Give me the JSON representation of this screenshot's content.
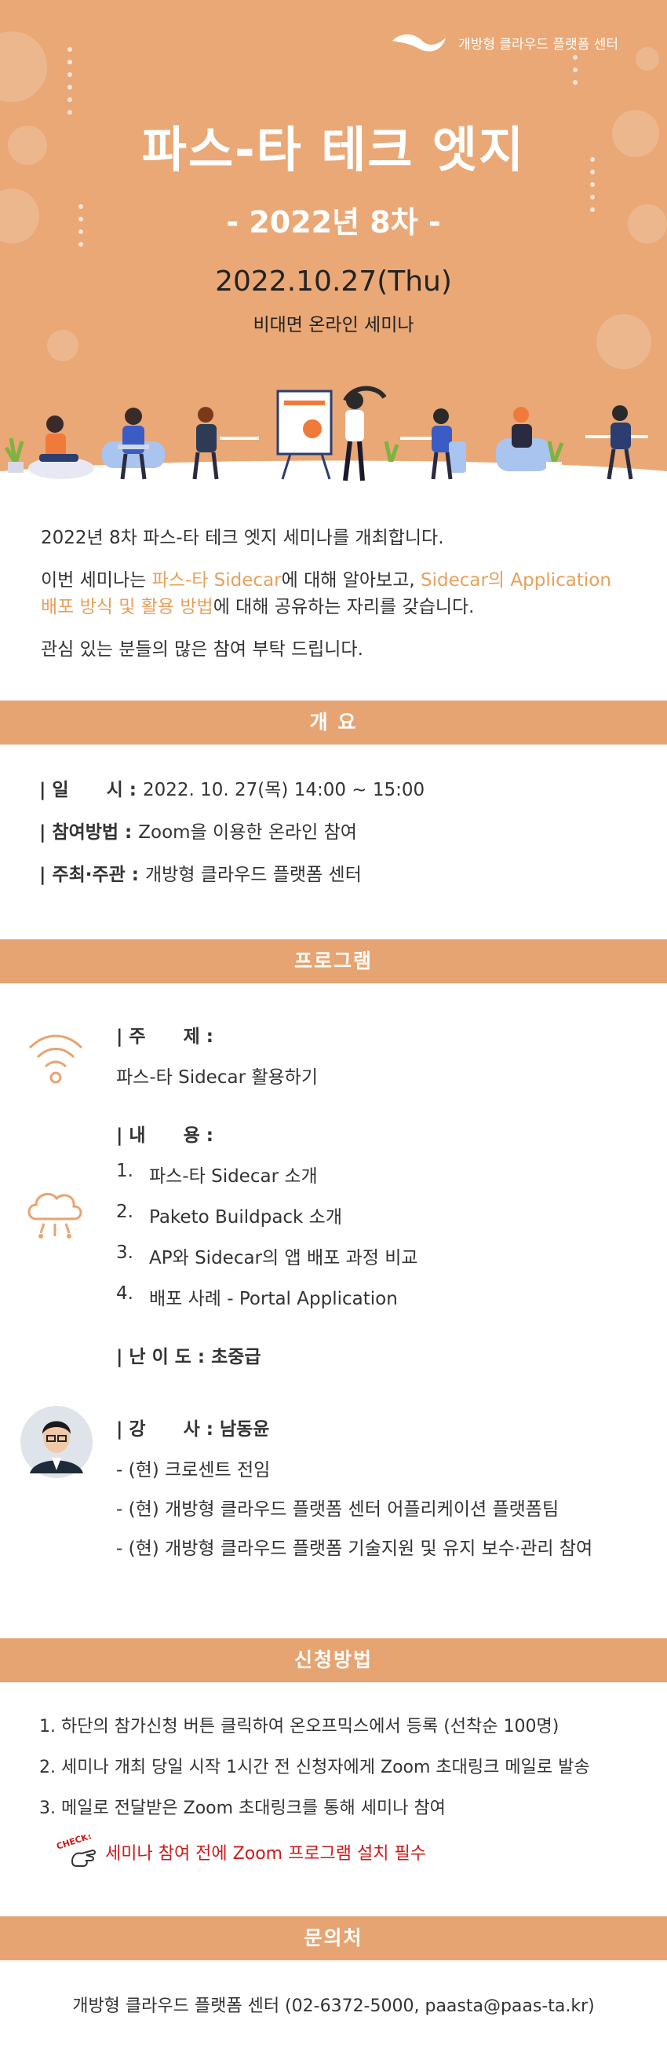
{
  "brand": {
    "name": "개방형 클라우드 플랫폼 센터",
    "logo_icon": "cloud-wave-logo"
  },
  "hero": {
    "title": "파스-타 테크 엣지",
    "subtitle": "- 2022년 8차 -",
    "date": "2022.10.27(Thu)",
    "kind": "비대면 온라인 세미나"
  },
  "intro": {
    "p1": "2022년 8차 파스-타 테크 엣지 세미나를 개최합니다.",
    "p2_pre": "이번 세미나는 ",
    "p2_hl1": "파스-타 Sidecar",
    "p2_mid": "에 대해 알아보고, ",
    "p2_hl2": "Sidecar의 Application 배포 방식 및 활용 방법",
    "p2_post": "에 대해 공유하는 자리를 갖습니다.",
    "p3": "관심 있는 분들의 많은 참여 부탁 드립니다."
  },
  "overview": {
    "header": "개    요",
    "rows": [
      {
        "key": "| 일      시 : ",
        "value": "2022. 10. 27(목) 14:00 ~ 15:00"
      },
      {
        "key": "| 참여방법 : ",
        "value": "Zoom을 이용한 온라인 참여"
      },
      {
        "key": "| 주최·주관 : ",
        "value": "개방형 클라우드 플랫폼 센터"
      }
    ]
  },
  "program": {
    "header": "프로그램",
    "topic_label": "| 주      제 :",
    "topic": "파스-타 Sidecar 활용하기",
    "content_label": "| 내      용 :",
    "contents": [
      {
        "num": "1.",
        "text": "파스-타 Sidecar 소개"
      },
      {
        "num": "2.",
        "text": "Paketo Buildpack 소개"
      },
      {
        "num": "3.",
        "text": "AP와 Sidecar의 앱 배포 과정 비교"
      },
      {
        "num": "4.",
        "text": "배포 사례 - Portal Application"
      }
    ],
    "level": "| 난 이 도 : 초중급",
    "speaker": "| 강      사 : 남동윤",
    "careers": [
      "- (현) 크로센트 전임",
      "- (현) 개방형 클라우드 플랫폼 센터 어플리케이션 플랫폼팀",
      "- (현) 개방형 클라우드 플랫폼 기술지원 및 유지 보수·관리 참여"
    ],
    "icons": {
      "topic": "wifi-icon",
      "content": "cloud-icon",
      "speaker": "speaker-avatar"
    }
  },
  "apply": {
    "header": "신청방법",
    "steps": [
      "1. 하단의 참가신청 버튼 클릭하여 온오프믹스에서 등록 (선착순 100명)",
      "2. 세미나 개최 당일 시작 1시간 전 신청자에게 Zoom 초대링크 메일로 발송",
      "3. 메일로 전달받은 Zoom 초대링크를 통해 세미나 참여"
    ],
    "check_badge": "CHECK!",
    "check_note": "세미나 참여 전에 Zoom 프로그램 설치 필수"
  },
  "contact": {
    "header": "문의처",
    "text": "개방형 클라우드 플랫폼 센터 (02-6372-5000, paasta@paas-ta.kr)"
  },
  "colors": {
    "accent": "#e6a472",
    "highlight": "#e6a15c",
    "alert": "#cc1a1a"
  }
}
